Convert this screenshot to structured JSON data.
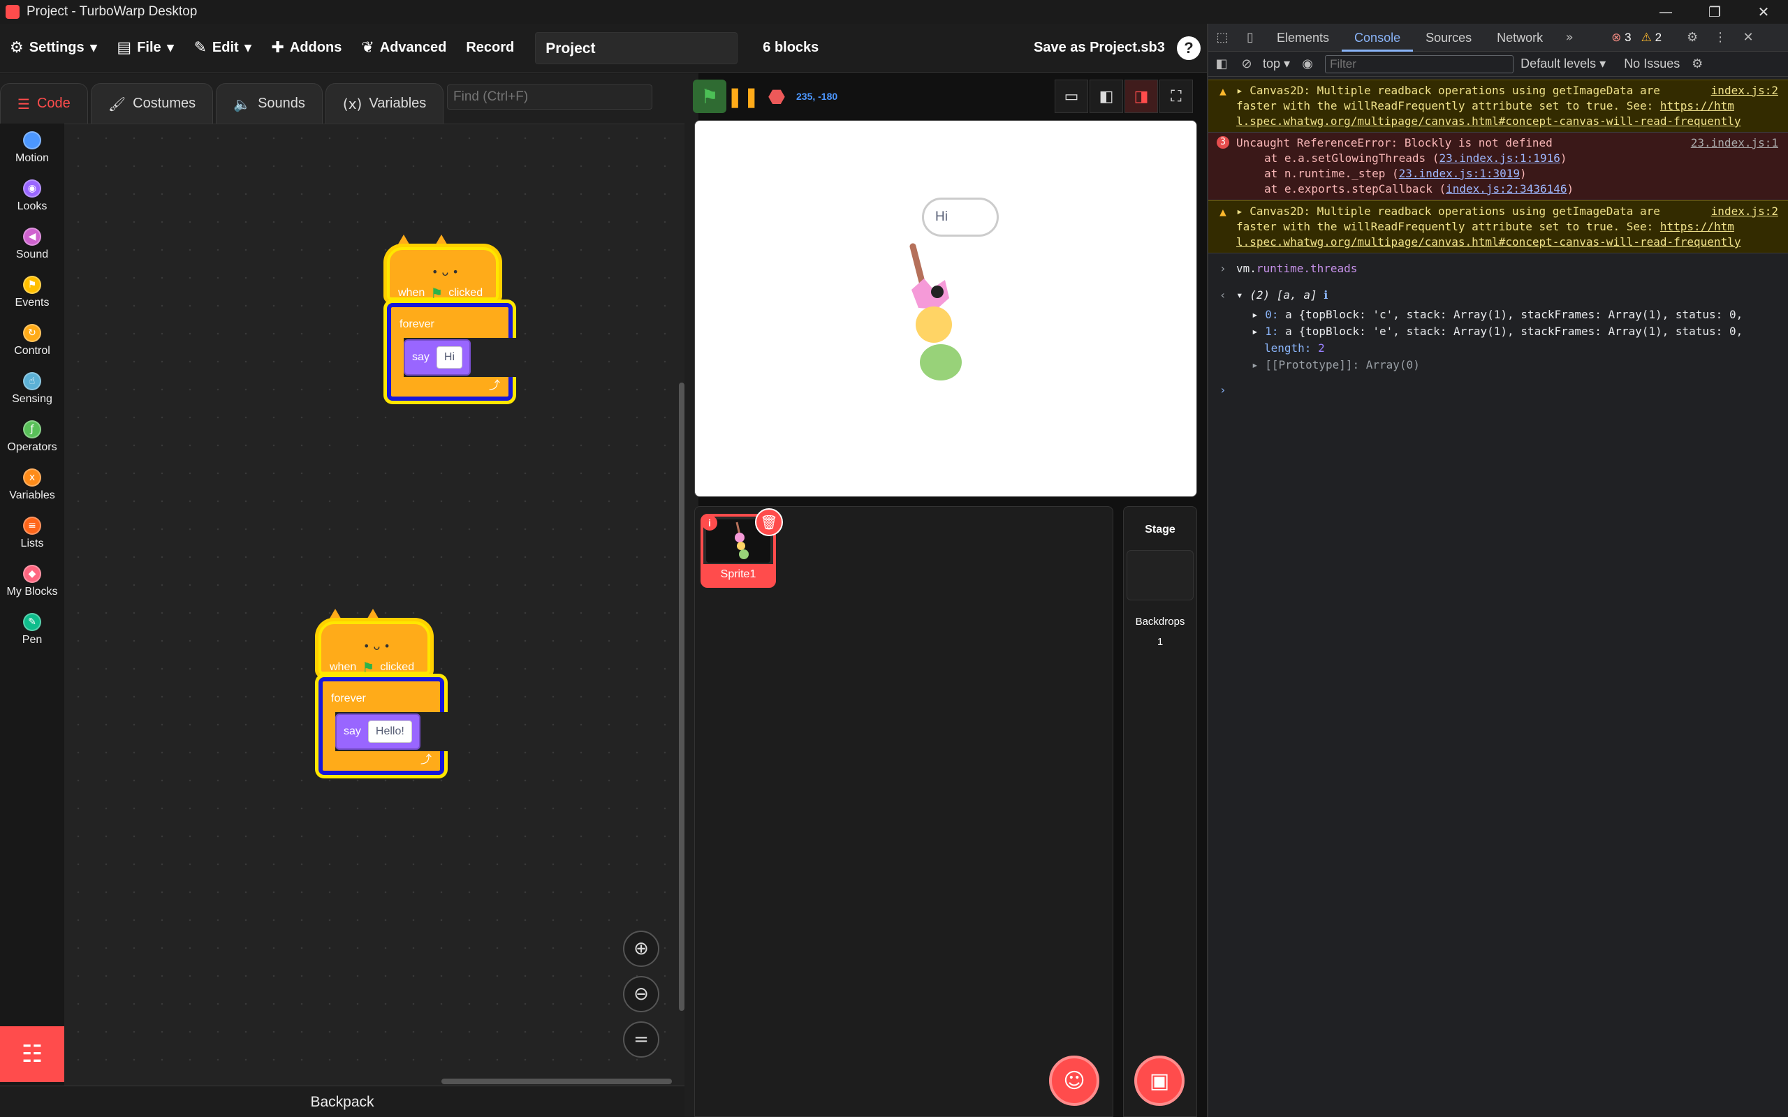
{
  "window": {
    "title": "Project - TurboWarp Desktop",
    "controls": [
      "—",
      "❐",
      "✕"
    ]
  },
  "menubar": {
    "settings": "Settings",
    "file": "File",
    "edit": "Edit",
    "addons": "Addons",
    "advanced": "Advanced",
    "record": "Record",
    "project_name": "Project",
    "block_count": "6 blocks",
    "save_as": "Save as Project.sb3",
    "help": "?"
  },
  "editor": {
    "tabs": [
      {
        "label": "Code",
        "icon": "code-icon"
      },
      {
        "label": "Costumes",
        "icon": "brush-icon"
      },
      {
        "label": "Sounds",
        "icon": "speaker-icon"
      },
      {
        "label": "Variables",
        "icon": "variable-icon"
      }
    ],
    "find_placeholder": "Find (Ctrl+F)",
    "categories": [
      {
        "label": "Motion",
        "color": "#4c97ff"
      },
      {
        "label": "Looks",
        "color": "#9966ff"
      },
      {
        "label": "Sound",
        "color": "#cf63cf"
      },
      {
        "label": "Events",
        "color": "#ffbf00"
      },
      {
        "label": "Control",
        "color": "#ffab19"
      },
      {
        "label": "Sensing",
        "color": "#5cb1d6"
      },
      {
        "label": "Operators",
        "color": "#59c059"
      },
      {
        "label": "Variables",
        "color": "#ff8c1a"
      },
      {
        "label": "Lists",
        "color": "#ff661a"
      },
      {
        "label": "My Blocks",
        "color": "#ff6680"
      },
      {
        "label": "Pen",
        "color": "#0fbd8c"
      }
    ],
    "backpack": "Backpack",
    "scripts": [
      {
        "hat_when": "when",
        "hat_clicked": "clicked",
        "loop": "forever",
        "say": "say",
        "say_value": "Hi"
      },
      {
        "hat_when": "when",
        "hat_clicked": "clicked",
        "loop": "forever",
        "say": "say",
        "say_value": "Hello!"
      }
    ]
  },
  "stage": {
    "coords": "235, -180",
    "speech_bubble": "Hi"
  },
  "sprites": {
    "selected": "Sprite1",
    "stage_label": "Stage",
    "backdrops_label": "Backdrops",
    "backdrops_count": "1"
  },
  "devtools": {
    "tabs": [
      "Elements",
      "Console",
      "Sources",
      "Network"
    ],
    "active_tab": "Console",
    "errors": "3",
    "warnings": "2",
    "context": "top",
    "filter_placeholder": "Filter",
    "levels": "Default levels",
    "issues": "No Issues",
    "messages": {
      "warn1": {
        "line1": "Canvas2D: Multiple readback operations using getImageData are",
        "line2": "faster with the willReadFrequently attribute set to true. See: ",
        "link_a": "https://htm",
        "link_b": "l.spec.whatwg.org/multipage/canvas.html#concept-canvas-will-read-frequently",
        "src": "index.js:2"
      },
      "err": {
        "count": "3",
        "text": "Uncaught ReferenceError: Blockly is not defined",
        "src": "23.index.js:1",
        "stack1_pre": "at e.a.setGlowingThreads (",
        "stack1_link": "23.index.js:1:1916",
        "stack2_pre": "at n.runtime._step (",
        "stack2_link": "23.index.js:1:3019",
        "stack3_pre": "at e.exports.stepCallback (",
        "stack3_link": "index.js:2:3436146"
      },
      "warn2": {
        "line1": "Canvas2D: Multiple readback operations using getImageData are",
        "line2": "faster with the willReadFrequently attribute set to true. See: ",
        "link_a": "https://htm",
        "link_b": "l.spec.whatwg.org/multipage/canvas.html#concept-canvas-will-read-frequently",
        "src": "index.js:2"
      },
      "command": {
        "obj": "vm.",
        "path": "runtime.threads"
      },
      "result": {
        "summary": "(2) [a, a]",
        "item0_key": "0:",
        "item0_text": "a {topBlock: 'c', stack: Array(1), stackFrames: Array(1), status: 0,",
        "item1_key": "1:",
        "item1_text": "a {topBlock: 'e', stack: Array(1), stackFrames: Array(1), status: 0,",
        "length_key": "length:",
        "length_val": "2",
        "proto": "[[Prototype]]: Array(0)"
      }
    }
  }
}
